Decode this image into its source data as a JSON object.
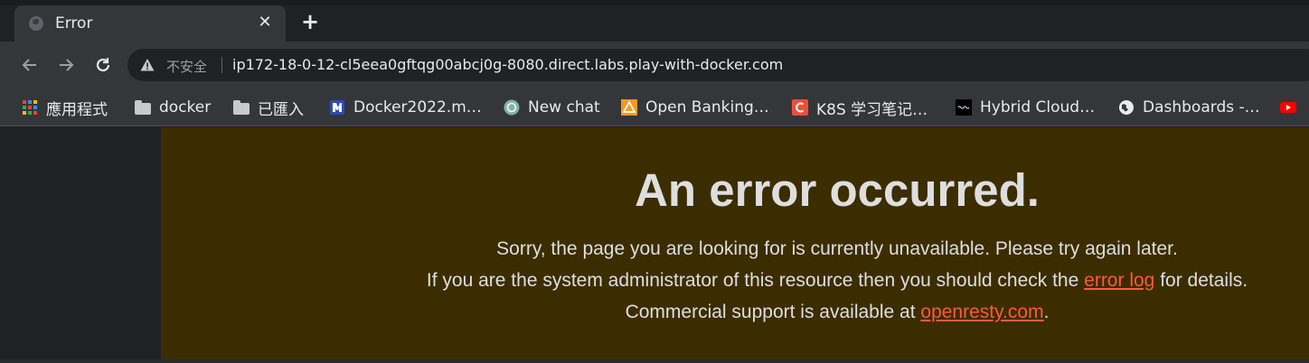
{
  "tab": {
    "title": "Error",
    "close_glyph": "✕",
    "favicon": "globe-icon"
  },
  "new_tab_glyph": "+",
  "toolbar": {
    "security_label": "不安全",
    "url": "ip172-18-0-12-cl5eea0gftqg00abcj0g-8080.direct.labs.play-with-docker.com"
  },
  "bookmarks": [
    {
      "label": "應用程式",
      "icon": "apps-grid-icon"
    },
    {
      "label": "docker",
      "icon": "folder-icon"
    },
    {
      "label": "已匯入",
      "icon": "folder-icon"
    },
    {
      "label": "Docker2022.m…",
      "icon": "docker-doc-icon"
    },
    {
      "label": "New chat",
      "icon": "chatgpt-icon"
    },
    {
      "label": "Open Banking…",
      "icon": "open-banking-icon"
    },
    {
      "label": "K8S 学习笔记…",
      "icon": "c-logo-icon"
    },
    {
      "label": "Hybrid Cloud…",
      "icon": "hybrid-cloud-icon"
    },
    {
      "label": "Dashboards -…",
      "icon": "globe-icon"
    }
  ],
  "page": {
    "heading": "An error occurred.",
    "line1": "Sorry, the page you are looking for is currently unavailable. Please try again later.",
    "line2_prefix": "If you are the system administrator of this resource then you should check the",
    "line2_link": "error log",
    "line2_suffix": "for details.",
    "line3_prefix": "Commercial support is available at",
    "line3_link": "openresty.com",
    "line3_suffix": "."
  },
  "colors": {
    "page_background": "#3b2d00",
    "text": "#dedede",
    "link": "#ff5a3c"
  }
}
